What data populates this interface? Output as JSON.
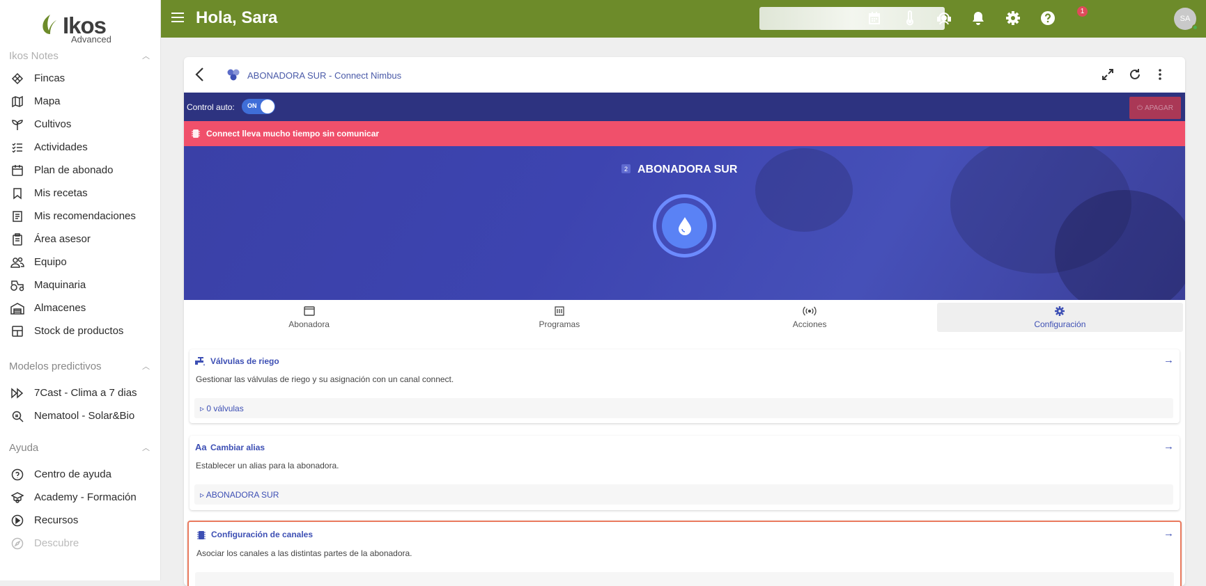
{
  "app": {
    "logo_text": "Ikos",
    "logo_sub": "Advanced",
    "greeting": "Hola, Sara"
  },
  "topbar": {
    "notification_count": "1",
    "avatar_initials": "SA"
  },
  "sidebar": {
    "section_notes": "Ikos Notes",
    "notes_items": [
      {
        "label": "Fincas",
        "icon": "field-icon"
      },
      {
        "label": "Mapa",
        "icon": "map-icon"
      },
      {
        "label": "Cultivos",
        "icon": "sprout-icon"
      },
      {
        "label": "Actividades",
        "icon": "checklist-icon"
      },
      {
        "label": "Plan de abonado",
        "icon": "calendar-icon"
      },
      {
        "label": "Mis recetas",
        "icon": "bookmark-icon"
      },
      {
        "label": "Mis recomendaciones",
        "icon": "receipt-icon"
      },
      {
        "label": "Área asesor",
        "icon": "clipboard-icon"
      },
      {
        "label": "Equipo",
        "icon": "team-icon"
      },
      {
        "label": "Maquinaria",
        "icon": "tractor-icon"
      },
      {
        "label": "Almacenes",
        "icon": "warehouse-icon"
      },
      {
        "label": "Stock de productos",
        "icon": "box-icon"
      }
    ],
    "section_models": "Modelos predictivos",
    "models_items": [
      {
        "label": "7Cast - Clima a 7 dias",
        "icon": "fast-forward-icon"
      },
      {
        "label": "Nematool - Solar&Bio",
        "icon": "search-bug-icon"
      }
    ],
    "section_help": "Ayuda",
    "help_items": [
      {
        "label": "Centro de ayuda",
        "icon": "help-circle-icon"
      },
      {
        "label": "Academy - Formación",
        "icon": "graduation-icon"
      },
      {
        "label": "Recursos",
        "icon": "play-circle-icon"
      },
      {
        "label": "Descubre",
        "icon": "compass-icon"
      }
    ]
  },
  "card": {
    "title": "ABONADORA SUR - Connect Nimbus",
    "control_label": "Control auto:",
    "toggle_label": "ON",
    "off_button": "APAGAR",
    "alert_text": "Connect lleva mucho tiempo sin comunicar",
    "device_number": "2",
    "device_name": "ABONADORA SUR"
  },
  "tabs": [
    {
      "label": "Abonadora",
      "icon": "window-icon"
    },
    {
      "label": "Programas",
      "icon": "sliders-icon"
    },
    {
      "label": "Acciones",
      "icon": "signal-icon"
    },
    {
      "label": "Configuración",
      "icon": "gear-icon"
    }
  ],
  "sections": [
    {
      "title": "Válvulas de riego",
      "desc": "Gestionar las válvulas de riego y su asignación con un canal connect.",
      "value": "0 válvulas",
      "icon": "valve-icon"
    },
    {
      "title": "Cambiar alias",
      "desc": "Establecer un alias para la abonadora.",
      "value": "ABONADORA SUR",
      "icon": "alias-icon"
    },
    {
      "title": "Configuración de canales",
      "desc": "Asociar los canales a las distintas partes de la abonadora.",
      "icon": "chip-icon"
    }
  ],
  "colors": {
    "topbar": "#6d8b2a",
    "accent": "#3d4fb4",
    "alert": "#f0506b",
    "banner": "#3d44b0"
  }
}
